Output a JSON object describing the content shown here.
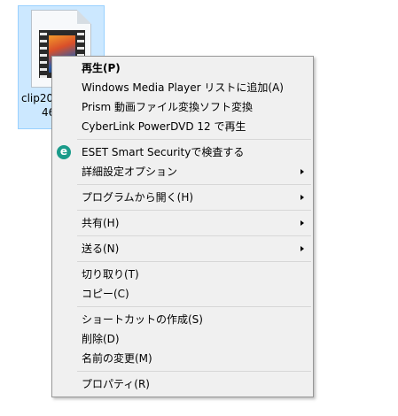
{
  "file": {
    "label_line1": "clip20",
    "label_line2": "46",
    "icon_letter": "M",
    "icon": "video-file-icon"
  },
  "menu": {
    "items": [
      {
        "label": "再生(P)",
        "bold": true
      },
      {
        "label": "Windows Media Player リストに追加(A)"
      },
      {
        "label": "Prism 動画ファイル変換ソフト変換"
      },
      {
        "label": "CyberLink PowerDVD 12 で再生"
      },
      {
        "label": "ESET Smart Securityで検査する",
        "icon": "eset-icon",
        "icon_glyph": "e"
      },
      {
        "label": "詳細設定オプション",
        "submenu": true
      },
      {
        "label": "プログラムから開く(H)",
        "submenu": true
      },
      {
        "label": "共有(H)",
        "submenu": true
      },
      {
        "label": "送る(N)",
        "submenu": true
      },
      {
        "label": "切り取り(T)"
      },
      {
        "label": "コピー(C)"
      },
      {
        "label": "ショートカットの作成(S)"
      },
      {
        "label": "削除(D)"
      },
      {
        "label": "名前の変更(M)"
      },
      {
        "label": "プロパティ(R)"
      }
    ]
  },
  "colors": {
    "selection": "#cce8ff",
    "menu_background": "#f0f0f0",
    "eset_accent": "#1a9b8a"
  }
}
